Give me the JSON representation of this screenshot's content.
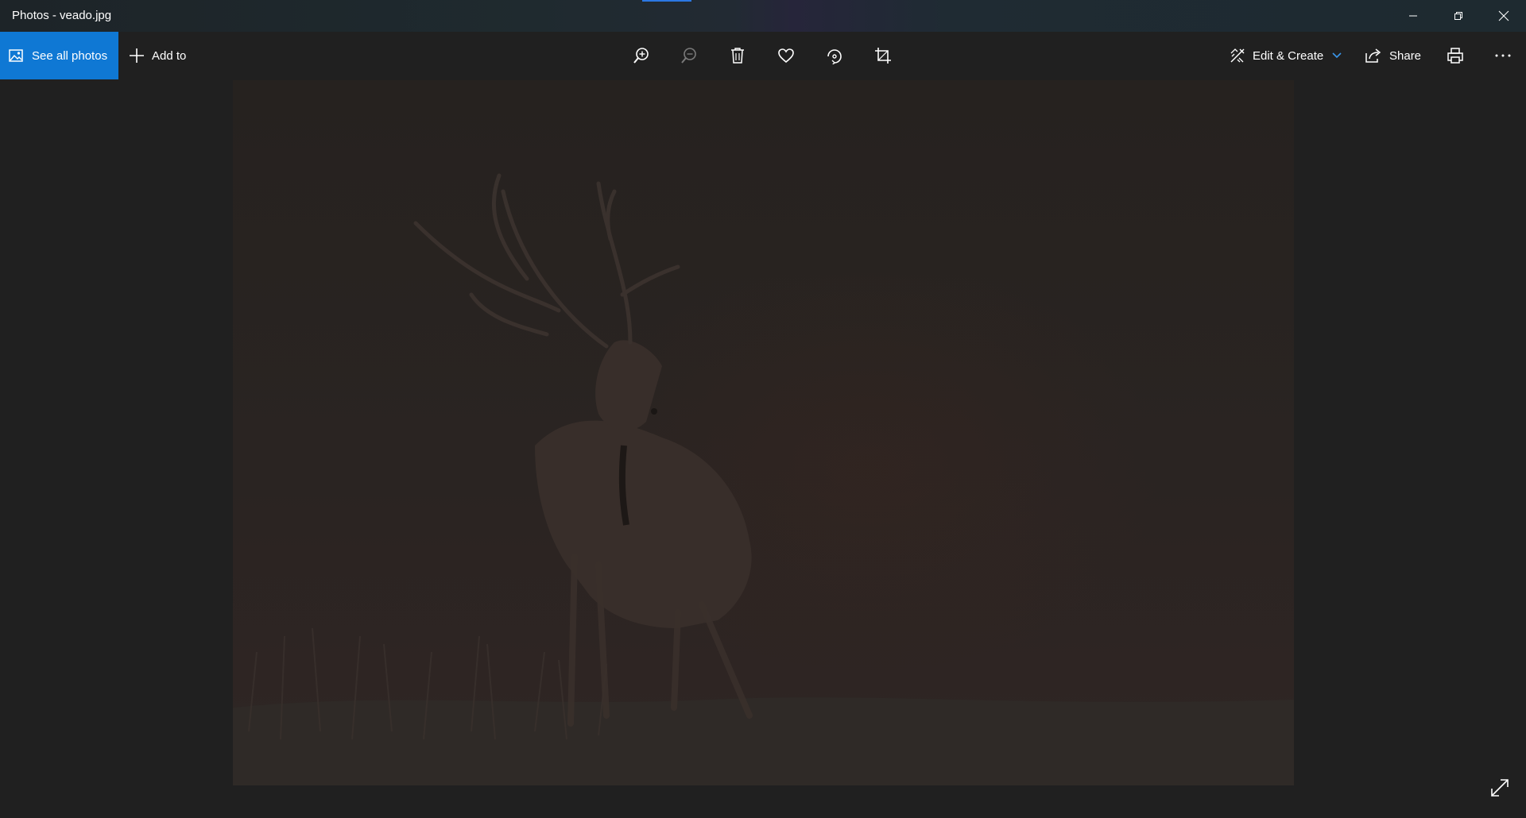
{
  "window": {
    "title": "Photos - veado.jpg",
    "minimize_icon": "minimize-icon",
    "maximize_icon": "restore-icon",
    "close_icon": "close-icon"
  },
  "toolbar": {
    "see_all_label": "See all photos",
    "add_to_label": "Add to",
    "edit_create_label": "Edit & Create",
    "share_label": "Share",
    "accent_color": "#0f78d4",
    "icons": [
      "photos-icon",
      "plus-icon",
      "zoom-in-icon",
      "zoom-out-icon",
      "delete-icon",
      "heart-icon",
      "rotate-icon",
      "crop-icon",
      "edit-create-icon",
      "chevron-down-icon",
      "share-icon",
      "print-icon",
      "more-icon"
    ]
  },
  "viewer": {
    "image_subject": "stag",
    "expand_icon": "expand-icon"
  }
}
